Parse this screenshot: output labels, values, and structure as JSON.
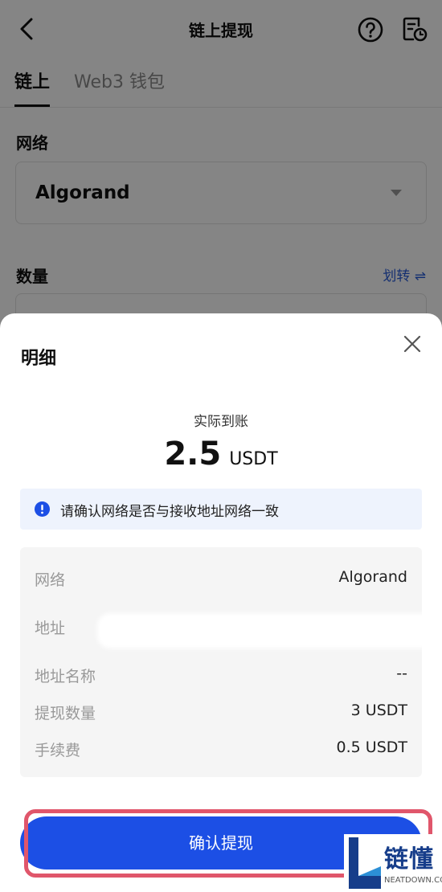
{
  "header": {
    "title": "链上提现",
    "back_icon": "chevron-left-icon",
    "help_icon": "question-circle-icon",
    "history_icon": "document-clock-icon"
  },
  "tabs": [
    {
      "label": "链上",
      "active": true
    },
    {
      "label": "Web3 钱包",
      "active": false
    }
  ],
  "form": {
    "network_label": "网络",
    "network_value": "Algorand",
    "amount_label": "数量",
    "transfer_link": "划转 ⇌"
  },
  "sheet": {
    "title": "明细",
    "received_label": "实际到账",
    "received_amount": "2.5",
    "received_unit": "USDT",
    "notice": "请确认网络是否与接收地址网络一致",
    "details": [
      {
        "label": "网络",
        "value": "Algorand"
      },
      {
        "label": "地址",
        "value": ""
      },
      {
        "label": "地址名称",
        "value": "--"
      },
      {
        "label": "提现数量",
        "value": "3 USDT"
      },
      {
        "label": "手续费",
        "value": "0.5 USDT"
      }
    ],
    "confirm_label": "确认提现"
  },
  "watermark": {
    "text": "链懂",
    "sub": "NEATDOWN.COM"
  },
  "colors": {
    "primary": "#1c4fe5",
    "notice_bg": "#eef3fd",
    "highlight": "#e0566b",
    "link": "#2a5dd8"
  }
}
